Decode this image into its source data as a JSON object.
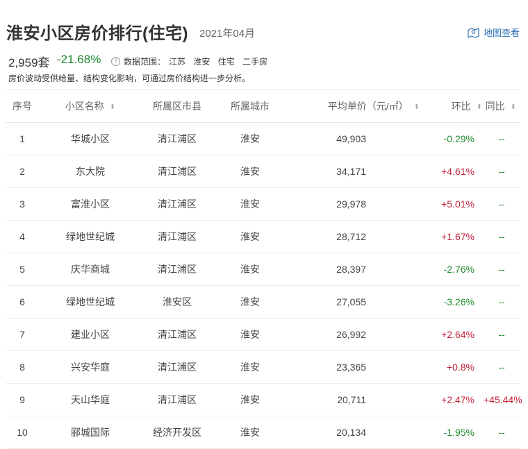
{
  "header": {
    "title": "淮安小区房价排行(住宅)",
    "date": "2021年04月",
    "map_link": "地图查看"
  },
  "summary": {
    "count": "2,959套",
    "change": "-21.68%",
    "scope_label": "数据范围：",
    "scope_tags": [
      "江苏",
      "淮安",
      "住宅",
      "二手房"
    ],
    "note": "房价波动受供给量、结构变化影响，可通过房价结构进一步分析。"
  },
  "table": {
    "headers": [
      "序号",
      "小区名称",
      "所属区市县",
      "所属城市",
      "平均单价（元/㎡）",
      "环比",
      "同比"
    ],
    "rows": [
      {
        "rank": "1",
        "name": "华城小区",
        "district": "清江浦区",
        "city": "淮安",
        "price": "49,903",
        "mom": "-0.29%",
        "yoy": "--"
      },
      {
        "rank": "2",
        "name": "东大院",
        "district": "清江浦区",
        "city": "淮安",
        "price": "34,171",
        "mom": "+4.61%",
        "yoy": "--"
      },
      {
        "rank": "3",
        "name": "富淮小区",
        "district": "清江浦区",
        "city": "淮安",
        "price": "29,978",
        "mom": "+5.01%",
        "yoy": "--"
      },
      {
        "rank": "4",
        "name": "绿地世纪城",
        "district": "清江浦区",
        "city": "淮安",
        "price": "28,712",
        "mom": "+1.67%",
        "yoy": "--"
      },
      {
        "rank": "5",
        "name": "庆华商城",
        "district": "清江浦区",
        "city": "淮安",
        "price": "28,397",
        "mom": "-2.76%",
        "yoy": "--"
      },
      {
        "rank": "6",
        "name": "绿地世纪城",
        "district": "淮安区",
        "city": "淮安",
        "price": "27,055",
        "mom": "-3.26%",
        "yoy": "--"
      },
      {
        "rank": "7",
        "name": "建业小区",
        "district": "清江浦区",
        "city": "淮安",
        "price": "26,992",
        "mom": "+2.64%",
        "yoy": "--"
      },
      {
        "rank": "8",
        "name": "兴安华庭",
        "district": "清江浦区",
        "city": "淮安",
        "price": "23,365",
        "mom": "+0.8%",
        "yoy": "--"
      },
      {
        "rank": "9",
        "name": "天山华庭",
        "district": "清江浦区",
        "city": "淮安",
        "price": "20,711",
        "mom": "+2.47%",
        "yoy": "+45.44%"
      },
      {
        "rank": "10",
        "name": "郦城国际",
        "district": "经济开发区",
        "city": "淮安",
        "price": "20,134",
        "mom": "-1.95%",
        "yoy": "--"
      }
    ]
  },
  "colors": {
    "positive": "#c0223b",
    "negative": "#1f8b2d",
    "link": "#2d6fb5"
  }
}
